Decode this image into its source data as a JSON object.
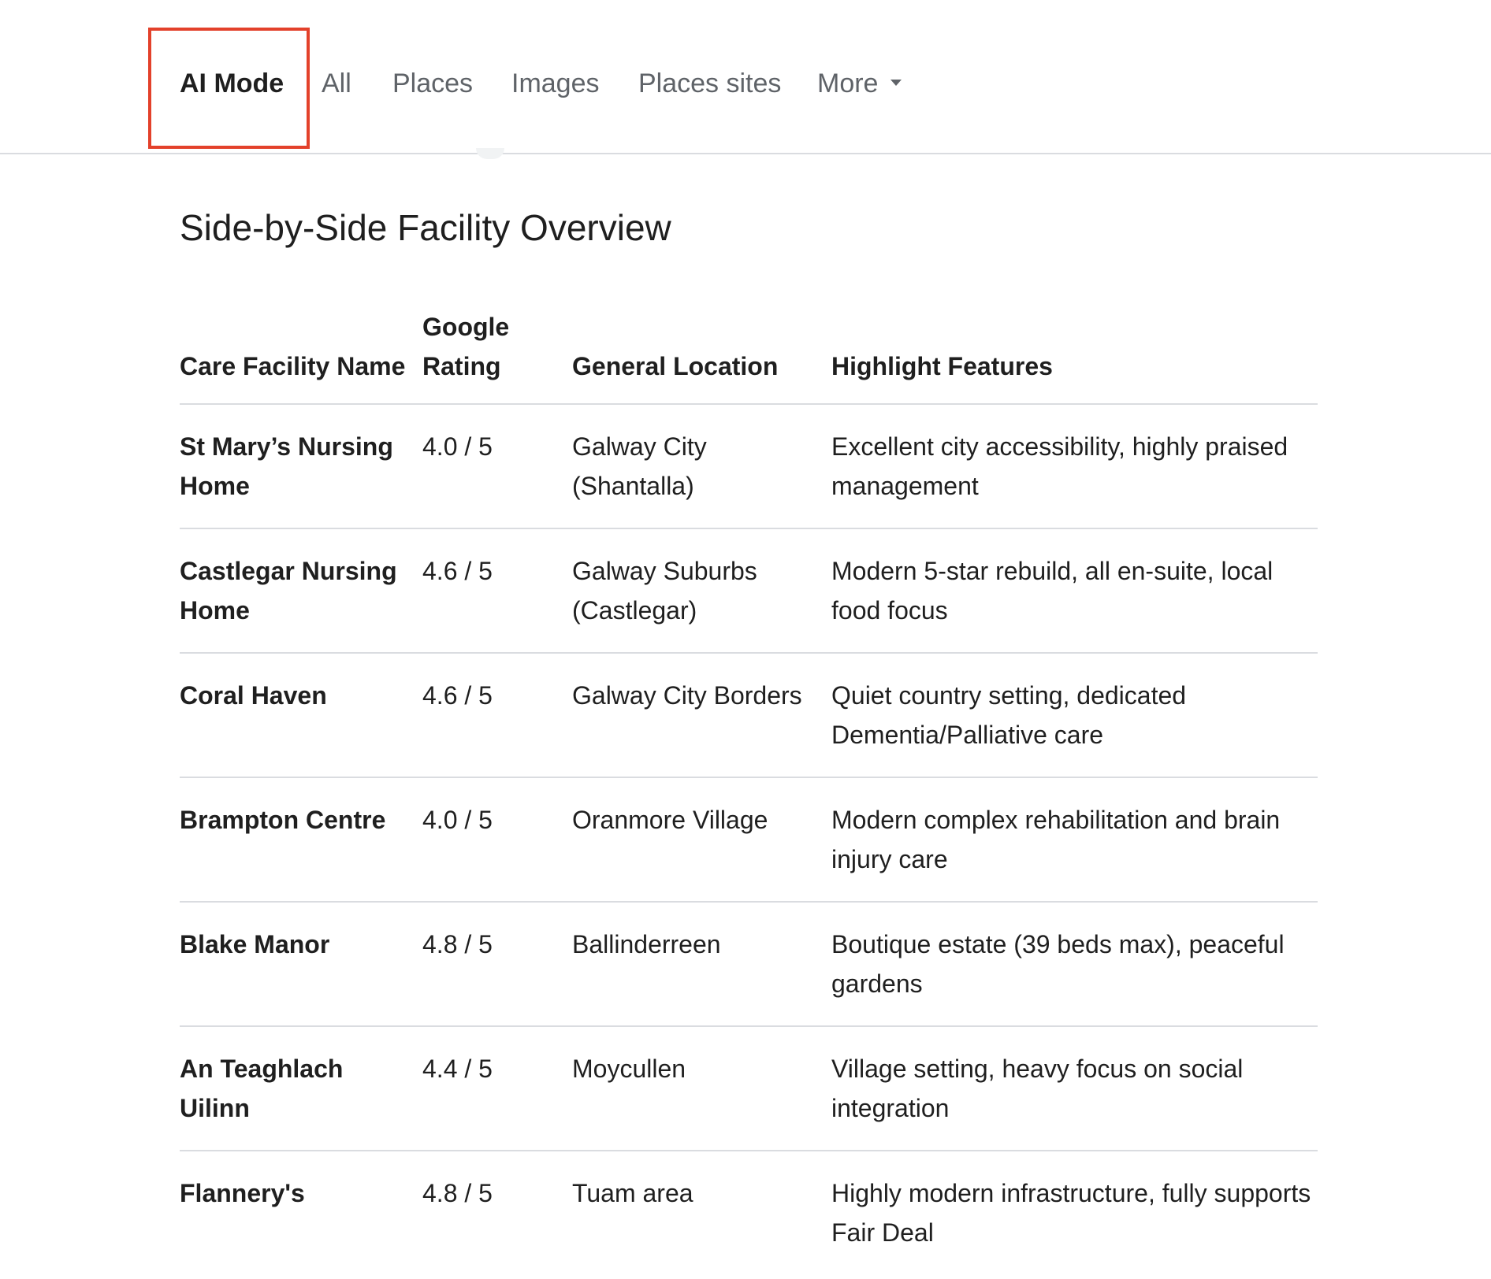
{
  "tabs": [
    {
      "label": "AI Mode"
    },
    {
      "label": "All"
    },
    {
      "label": "Places"
    },
    {
      "label": "Images"
    },
    {
      "label": "Places sites"
    },
    {
      "label": "More"
    }
  ],
  "highlight_color": "#e3412b",
  "section_title": "Side-by-Side Facility Overview",
  "table": {
    "headers": [
      "Care Facility Name",
      "Google Rating",
      "General Location",
      "Highlight Features"
    ],
    "rows": [
      {
        "name": "St Mary’s Nursing Home",
        "rating": "4.0 / 5",
        "location": "Galway City (Shantalla)",
        "features": "Excellent city accessibility, highly praised management"
      },
      {
        "name": "Castlegar Nursing Home",
        "rating": "4.6 / 5",
        "location": "Galway Suburbs (Castlegar)",
        "features": "Modern 5-star rebuild, all en-suite, local food focus"
      },
      {
        "name": "Coral Haven",
        "rating": "4.6 / 5",
        "location": "Galway City Borders",
        "features": "Quiet country setting, dedicated Dementia/Palliative care"
      },
      {
        "name": "Brampton Centre",
        "rating": "4.0 / 5",
        "location": "Oranmore Village",
        "features": "Modern complex rehabilitation and brain injury care"
      },
      {
        "name": "Blake Manor",
        "rating": "4.8 / 5",
        "location": "Ballinderreen",
        "features": "Boutique estate (39 beds max), peaceful gardens"
      },
      {
        "name": "An Teaghlach Uilinn",
        "rating": "4.4 / 5",
        "location": "Moycullen",
        "features": "Village setting, heavy focus on social integration"
      },
      {
        "name": "Flannery's",
        "rating": "4.8 / 5",
        "location": "Tuam area",
        "features": "Highly modern infrastructure, fully supports Fair Deal"
      }
    ]
  }
}
